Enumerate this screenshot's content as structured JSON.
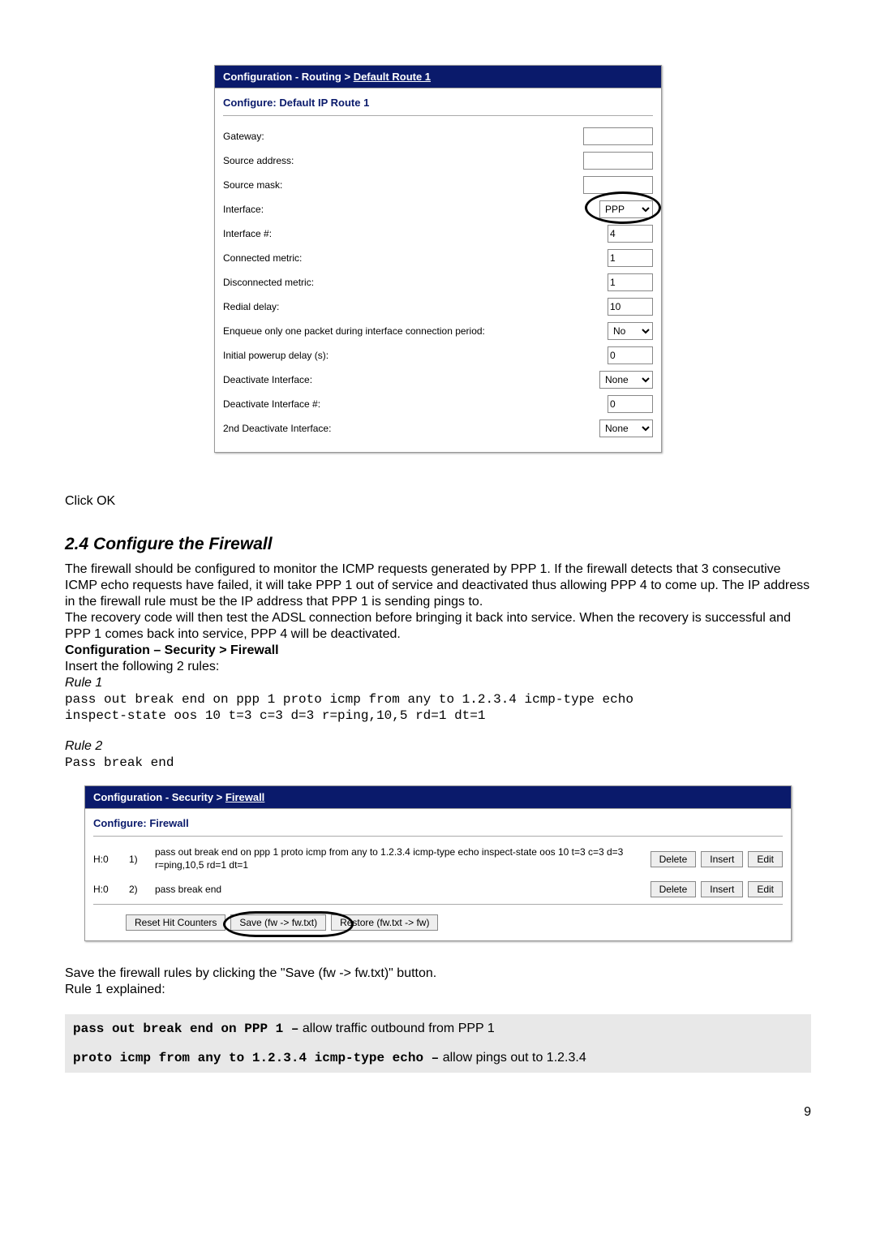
{
  "panel1": {
    "breadcrumb_prefix": "Configuration - Routing",
    "breadcrumb_sep": " > ",
    "breadcrumb_link": "Default Route 1",
    "section_title": "Configure: Default IP Route 1",
    "rows": {
      "gateway": {
        "label": "Gateway:",
        "value": ""
      },
      "src_addr": {
        "label": "Source address:",
        "value": ""
      },
      "src_mask": {
        "label": "Source mask:",
        "value": ""
      },
      "iface": {
        "label": "Interface:",
        "value": "PPP"
      },
      "iface_num": {
        "label": "Interface #:",
        "value": "4"
      },
      "conn_metric": {
        "label": "Connected metric:",
        "value": "1"
      },
      "disc_metric": {
        "label": "Disconnected metric:",
        "value": "1"
      },
      "redial": {
        "label": "Redial delay:",
        "value": "10"
      },
      "enqueue": {
        "label": "Enqueue only one packet during interface connection period:",
        "value": "No"
      },
      "powerup": {
        "label": "Initial powerup delay (s):",
        "value": "0"
      },
      "deact_if": {
        "label": "Deactivate Interface:",
        "value": "None"
      },
      "deact_if_num": {
        "label": "Deactivate Interface #:",
        "value": "0"
      },
      "deact_if2": {
        "label": "2nd Deactivate Interface:",
        "value": "None"
      }
    }
  },
  "narr": {
    "click_ok": "Click OK",
    "heading": "2.4   Configure the Firewall",
    "p1_a": "The firewall should be configured to monitor the ICMP requests generated by PPP 1.  If the firewall detects that 3 consecutive ICMP echo requests have failed, it will take PPP 1 out of service and deactivated thus allowing PPP 4 to come up.  The IP address in the firewall rule must be the IP address that PPP 1 is sending pings to.",
    "p1_b": "The recovery code will then test the ADSL connection before bringing it back into service. When the recovery is successful and PPP 1 comes back into service, PPP 4 will be deactivated.",
    "cfg_path": "Configuration – Security > Firewall",
    "insert": "Insert the following 2 rules:",
    "rule1_lbl": "Rule 1",
    "rule1_code": "pass out break end on ppp 1 proto icmp from any to 1.2.3.4 icmp-type echo\ninspect-state oos 10 t=3 c=3 d=3 r=ping,10,5 rd=1 dt=1",
    "rule2_lbl": "Rule 2",
    "rule2_code": "Pass break end",
    "after1": "Save the firewall rules by clicking the \"Save (fw -> fw.txt)\" button.",
    "after2": "Rule 1 explained:",
    "shade1_code": "pass out break end on PPP 1 –",
    "shade1_txt": " allow traffic outbound from PPP 1",
    "shade2_code": "proto icmp from any to 1.2.3.4 icmp-type echo –",
    "shade2_txt": " allow pings out to 1.2.3.4"
  },
  "panel2": {
    "breadcrumb_prefix": "Configuration - Security",
    "breadcrumb_sep": " > ",
    "breadcrumb_link": "Firewall",
    "section_title": "Configure: Firewall",
    "rules": [
      {
        "hit": "H:0",
        "idx": "1)",
        "text": "pass out break end on ppp 1 proto icmp from any to 1.2.3.4 icmp-type echo inspect-state oos 10 t=3 c=3 d=3 r=ping,10,5 rd=1 dt=1"
      },
      {
        "hit": "H:0",
        "idx": "2)",
        "text": "pass break end"
      }
    ],
    "btn_delete": "Delete",
    "btn_insert": "Insert",
    "btn_edit": "Edit",
    "btn_reset": "Reset Hit Counters",
    "btn_save": "Save  (fw  -> fw.txt)",
    "btn_restore": "Restore (fw.txt -> fw)"
  },
  "page_number": "9"
}
